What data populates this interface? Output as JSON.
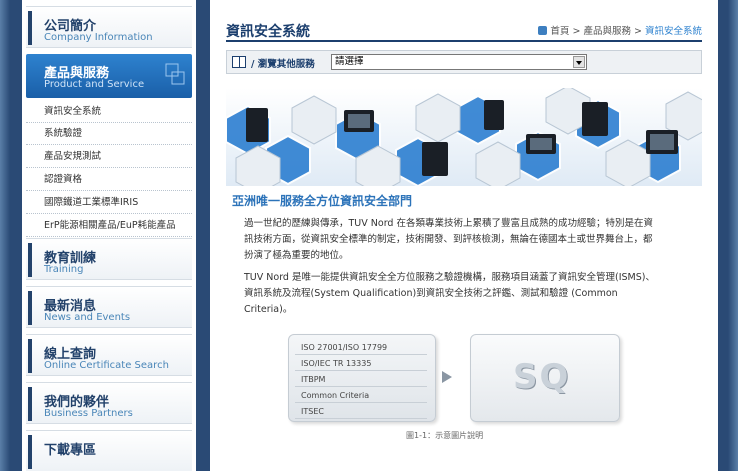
{
  "sidebar": {
    "company": {
      "zh": "公司簡介",
      "en": "Company Information"
    },
    "products": {
      "zh": "產品與服務",
      "en": "Product and Service"
    },
    "subitems": [
      {
        "label": "資訊安全系統"
      },
      {
        "label": "系統驗證"
      },
      {
        "label": "產品安規測試"
      },
      {
        "label": "認證資格"
      },
      {
        "label": "國際鐵道工業標準IRIS"
      },
      {
        "label": "ErP能源相關產品/EuP耗能產品"
      }
    ],
    "training": {
      "zh": "教育訓練",
      "en": "Training"
    },
    "news": {
      "zh": "最新消息",
      "en": "News and Events"
    },
    "online": {
      "zh": "線上查詢",
      "en": "Online Certificate Search"
    },
    "partners": {
      "zh": "我們的夥伴",
      "en": "Business Partners"
    },
    "download": {
      "zh": "下載專區"
    }
  },
  "main": {
    "title": "資訊安全系統",
    "breadcrumb": {
      "home": "首頁",
      "sep": ">",
      "parent": "產品與服務",
      "current": "資訊安全系統"
    },
    "browse": {
      "label": "/ 瀏覽其他服務",
      "select_value": "請選擇"
    },
    "headline": "亞洲唯一服務全方位資訊安全部門",
    "para1": "過一世紀的歷練與傳承，TUV Nord 在各類專業技術上累積了豐富且成熟的成功經驗；特別是在資訊技術方面，從資訊安全標準的制定，技術開發、到評核檢測，無論在德國本土或世界舞台上，都扮演了極為重要的地位。",
    "para2": "TUV Nord 是唯一能提供資訊安全全方位服務之驗證機構，服務項目涵蓋了資訊安全管理(ISMS)、資訊系統及流程(System Qualification)到資訊安全技術之評鑑、測試和驗證 (Common Criteria)。",
    "diagram": {
      "items": [
        "ISO 27001/ISO 17799",
        "ISO/IEC TR 13335",
        "ITBPM",
        "Common Criteria",
        "ITSEC"
      ],
      "sq_text": "SQ",
      "caption": "圖1-1：示意圖片說明"
    }
  },
  "colors": {
    "accent": "#2e82cf",
    "navy": "#1c3f6e",
    "link_blue": "#4a86b8"
  }
}
